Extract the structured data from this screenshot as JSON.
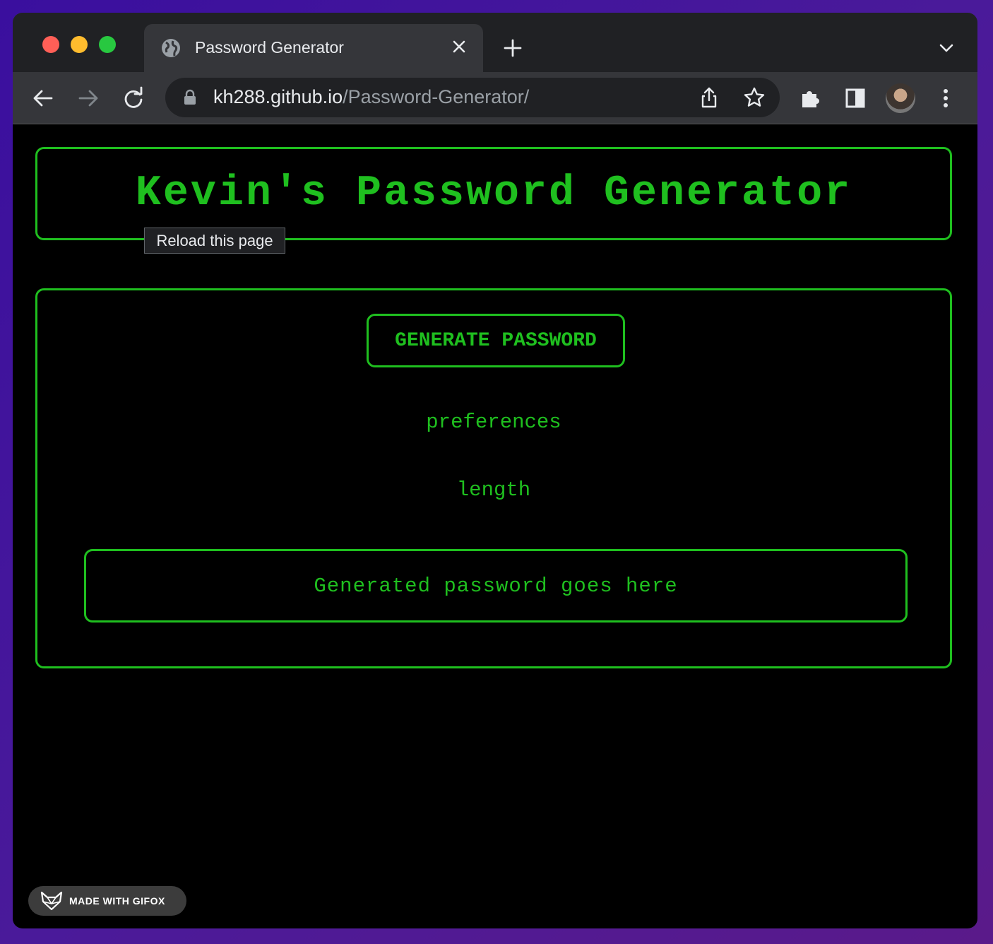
{
  "browser": {
    "tab": {
      "title": "Password Generator"
    },
    "address": {
      "domain": "kh288.github.io",
      "path": "/Password-Generator/"
    },
    "tooltip": "Reload this page"
  },
  "page": {
    "title": "Kevin's Password Generator",
    "generate_button": "GENERATE PASSWORD",
    "preferences_label": "preferences",
    "length_label": "length",
    "password_placeholder": "Generated password goes here"
  },
  "watermark": {
    "text": "MADE WITH GIFOX"
  },
  "colors": {
    "accent": "#1fbf1f",
    "background": "#000000",
    "chrome_dark": "#202124",
    "chrome_toolbar": "#35363a"
  },
  "icons": {
    "traffic_lights": [
      "close-light",
      "minimize-light",
      "maximize-light"
    ],
    "toolbar": [
      "back-arrow-icon",
      "forward-arrow-icon",
      "reload-icon",
      "lock-icon",
      "share-icon",
      "star-icon",
      "extensions-icon",
      "side-panel-icon",
      "avatar",
      "kebab-menu-icon"
    ]
  }
}
